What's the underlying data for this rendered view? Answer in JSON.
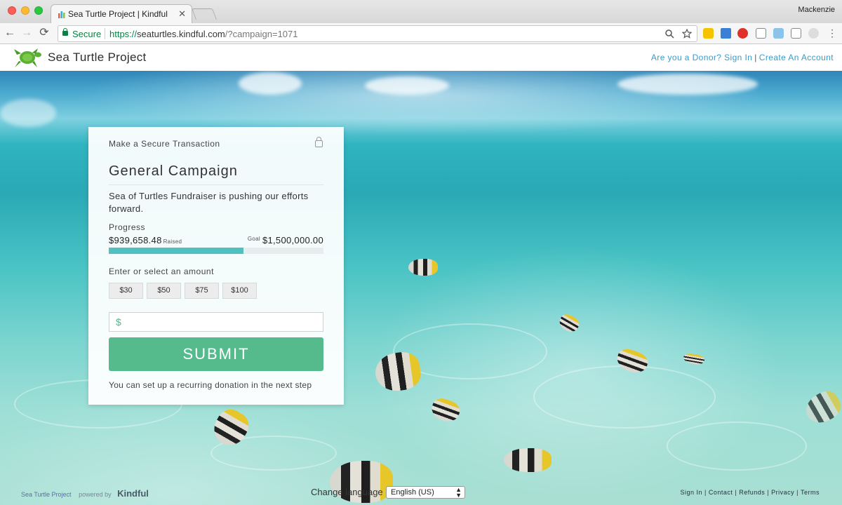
{
  "browser": {
    "tab_title": "Sea Turtle Project | Kindful",
    "tab_close": "✕",
    "profile_name": "Mackenzie",
    "secure_label": "Secure",
    "url_scheme": "https://",
    "url_host": "seaturtles.kindful.com",
    "url_path": "/?campaign=1071",
    "back": "←",
    "forward": "→",
    "reload": "⟳"
  },
  "header": {
    "site_name": "Sea Turtle Project",
    "donor_signin": "Are you a Donor? Sign In",
    "separator": "|",
    "create_account": "Create An Account"
  },
  "card": {
    "heading": "Make a Secure Transaction",
    "campaign_title": "General Campaign",
    "description": "Sea of Turtles Fundraiser is pushing our efforts forward.",
    "progress_label": "Progress",
    "raised_amount": "$939,658.48",
    "raised_label": "Raised",
    "goal_label": "Goal",
    "goal_amount": "$1,500,000.00",
    "progress_fraction": 0.6264,
    "amount_label": "Enter or select an amount",
    "amount_options": [
      "$30",
      "$50",
      "$75",
      "$100"
    ],
    "currency_symbol": "$",
    "submit_label": "SUBMIT",
    "recurring_note": "You can set up a recurring donation in the next step"
  },
  "footer": {
    "project_link": "Sea Turtle Project",
    "powered_by": "powered by",
    "brand": "Kindful",
    "change_language": "Change language",
    "language_value": "English (US)",
    "links": [
      "Sign In",
      "Contact",
      "Refunds",
      "Privacy",
      "Terms"
    ]
  },
  "colors": {
    "accent": "#55bb8d",
    "progress": "#51c0c0",
    "link": "#3a9bc7"
  }
}
